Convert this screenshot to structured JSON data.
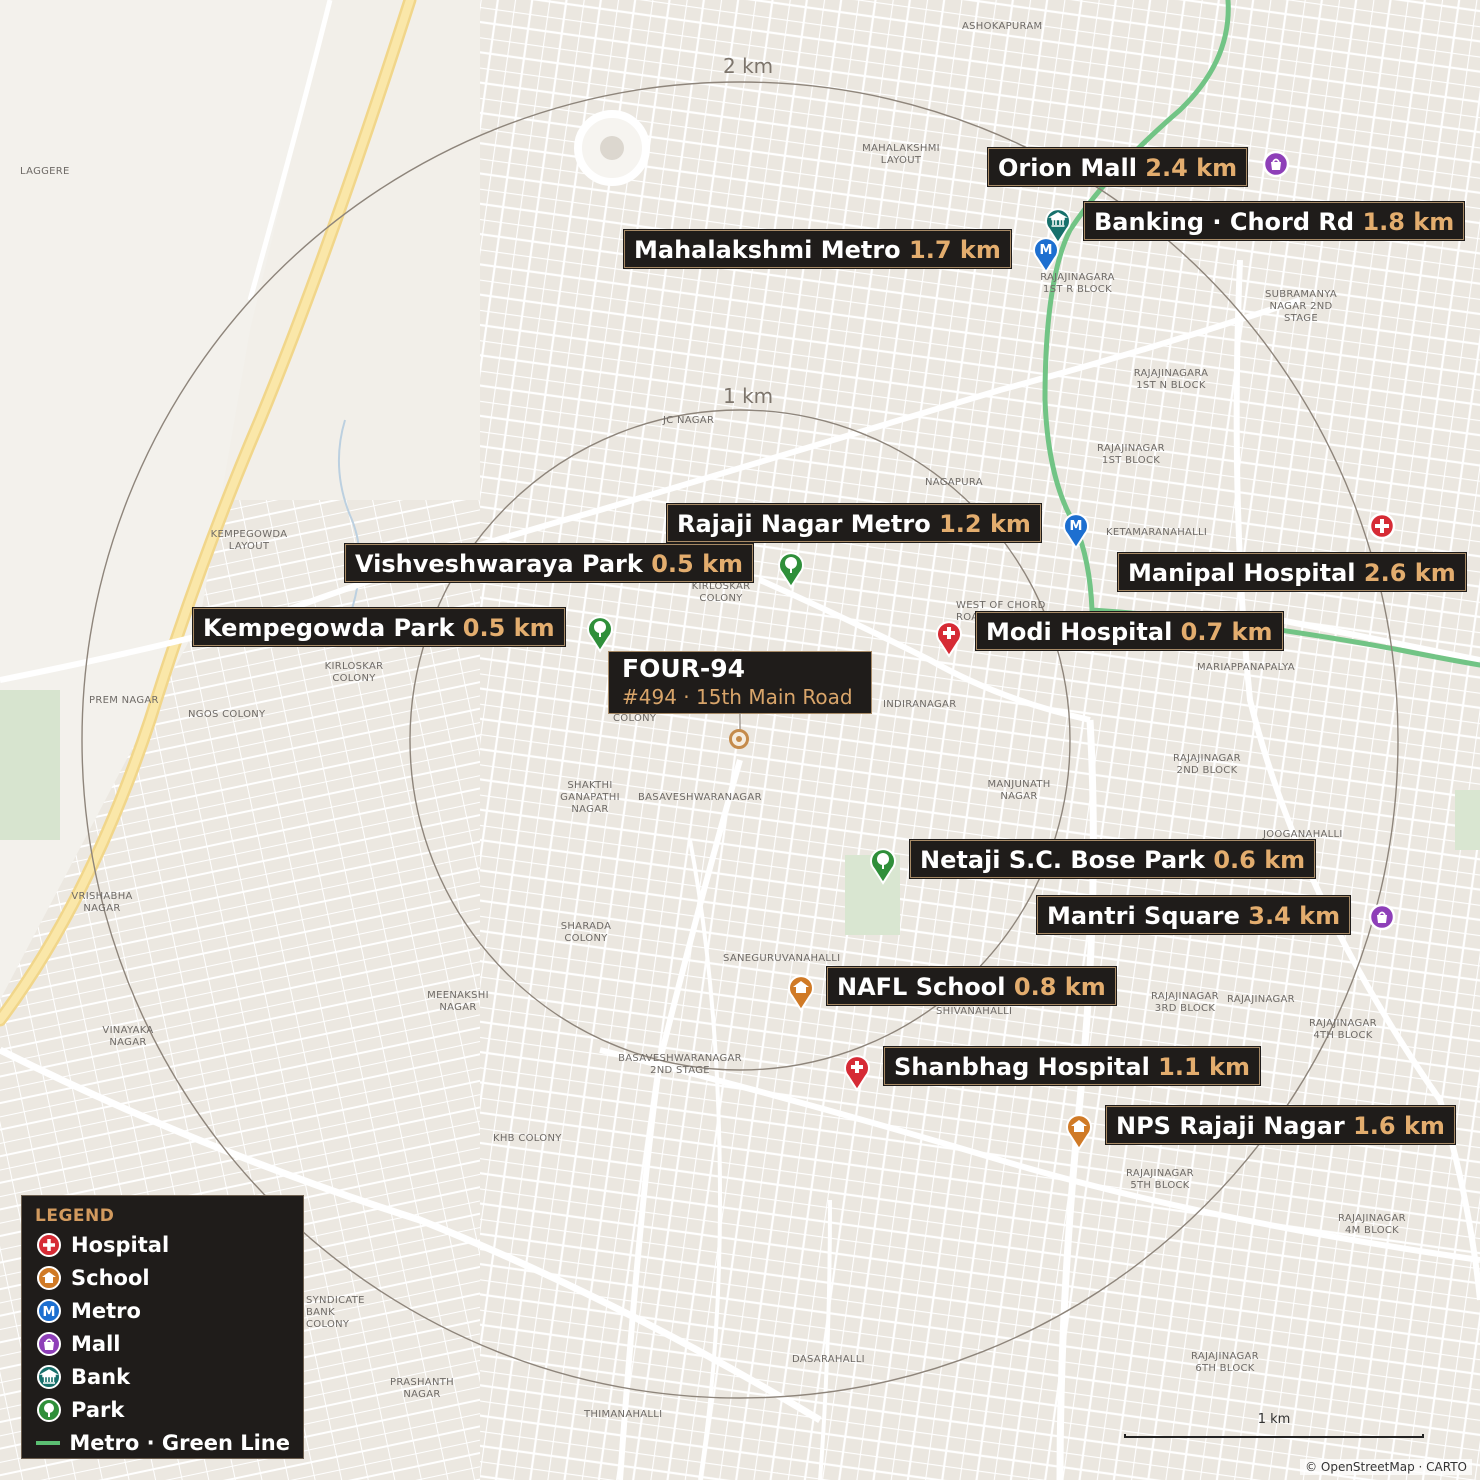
{
  "rings": [
    {
      "label": "1 km"
    },
    {
      "label": "2 km"
    }
  ],
  "property": {
    "name": "FOUR-94",
    "address": "#494 · 15th Main Road"
  },
  "pois": [
    {
      "name": "Orion Mall",
      "distance": "2.4 km",
      "category": "mall",
      "icon": "mall-icon"
    },
    {
      "name": "Banking · Chord Rd",
      "distance": "1.8 km",
      "category": "bank",
      "icon": "bank-icon"
    },
    {
      "name": "Mahalakshmi Metro",
      "distance": "1.7 km",
      "category": "metro",
      "icon": "metro-icon"
    },
    {
      "name": "Rajaji Nagar Metro",
      "distance": "1.2 km",
      "category": "metro",
      "icon": "metro-icon"
    },
    {
      "name": "Vishveshwaraya Park",
      "distance": "0.5 km",
      "category": "park",
      "icon": "park-icon"
    },
    {
      "name": "Manipal Hospital",
      "distance": "2.6 km",
      "category": "hospital",
      "icon": "hospital-icon"
    },
    {
      "name": "Kempegowda Park",
      "distance": "0.5 km",
      "category": "park",
      "icon": "park-icon"
    },
    {
      "name": "Modi Hospital",
      "distance": "0.7 km",
      "category": "hospital",
      "icon": "hospital-icon"
    },
    {
      "name": "Netaji S.C. Bose Park",
      "distance": "0.6 km",
      "category": "park",
      "icon": "park-icon"
    },
    {
      "name": "Mantri Square",
      "distance": "3.4 km",
      "category": "mall",
      "icon": "mall-icon"
    },
    {
      "name": "NAFL School",
      "distance": "0.8 km",
      "category": "school",
      "icon": "school-icon"
    },
    {
      "name": "Shanbhag Hospital",
      "distance": "1.1 km",
      "category": "hospital",
      "icon": "hospital-icon"
    },
    {
      "name": "NPS Rajaji Nagar",
      "distance": "1.6 km",
      "category": "school",
      "icon": "school-icon"
    }
  ],
  "legend": {
    "title": "LEGEND",
    "items": [
      {
        "label": "Hospital",
        "icon": "hospital-icon",
        "color": "#d62b35"
      },
      {
        "label": "School",
        "icon": "school-icon",
        "color": "#d07a26"
      },
      {
        "label": "Metro",
        "icon": "metro-icon",
        "color": "#1d6fd0"
      },
      {
        "label": "Mall",
        "icon": "mall-icon",
        "color": "#8e3fb8"
      },
      {
        "label": "Bank",
        "icon": "bank-icon",
        "color": "#17706b"
      },
      {
        "label": "Park",
        "icon": "park-icon",
        "color": "#2f8f3a"
      },
      {
        "label": "Metro · Green Line",
        "icon": "metro-line-icon",
        "color": "#5bbf72"
      }
    ]
  },
  "scale": {
    "label": "1 km"
  },
  "attribution": "© OpenStreetMap · CARTO",
  "area_labels": {
    "ashokapuram": "ASHOKAPURAM",
    "laggere": "LAGGERE",
    "mahalakshmi": "MAHALAKSHMI LAYOUT",
    "rajajinagara_1r": "RAJAJINAGARA 1ST R BLOCK",
    "subramanya": "SUBRAMANYA NAGAR 2ND STAGE",
    "rajajinagara_1n": "RAJAJINAGARA 1ST N BLOCK",
    "jc_nagar": "JC NAGAR",
    "rajajinagar_1st": "RAJAJINAGAR 1ST BLOCK",
    "nagapura": "NAGAPURA",
    "ketamaranahalli": "KETAMARANAHALLI",
    "kempegowda_layout": "KEMPEGOWDA LAYOUT",
    "kirloskar_colony_n": "KIRLOSKAR COLONY",
    "west_of_chord": "WEST OF CHORD ROAD",
    "kirloskar_colony": "KIRLOSKAR COLONY",
    "mariappanapalya": "MARIAPPANAPALYA",
    "prem_nagar": "PREM NAGAR",
    "ngos_colony": "NGOS COLONY",
    "indiranagar": "INDIRANAGAR",
    "colony": "COLONY",
    "rajajinagar_2nd": "RAJAJINAGAR 2ND BLOCK",
    "shakthi": "SHAKTHI GANAPATHI NAGAR",
    "basaveshwaranagar": "BASAVESHWARANAGAR",
    "manjunath": "MANJUNATH NAGAR",
    "joogana": "JOOGANAHALLI",
    "vrishabha": "VRISHABHA NAGAR",
    "sharada": "SHARADA COLONY",
    "saneguruvanahalli": "SANEGURUVANAHALLI",
    "meenakshi": "MEENAKSHI NAGAR",
    "shivanahalli": "SHIVANAHALLI",
    "rajajinagar_3rd": "RAJAJINAGAR 3RD BLOCK",
    "rajajinagar": "RAJAJINAGAR",
    "rajajinagar_4th": "RAJAJINAGAR 4TH BLOCK",
    "vinayaka": "VINAYAKA NAGAR",
    "basav_2nd": "BASAVESHWARANAGAR 2ND STAGE",
    "khb": "KHB COLONY",
    "rajajinagar_5th": "RAJAJINAGAR 5TH BLOCK",
    "rajajinagar_4m": "RAJAJINAGAR 4M BLOCK",
    "syndicate": "SYNDICATE BANK COLONY",
    "dasarahalli": "DASARAHALLI",
    "prashanth": "PRASHANTH NAGAR",
    "thimanahalli": "THIMANAHALLI",
    "rajajinagar_6th": "RAJAJINAGAR 6TH BLOCK"
  }
}
